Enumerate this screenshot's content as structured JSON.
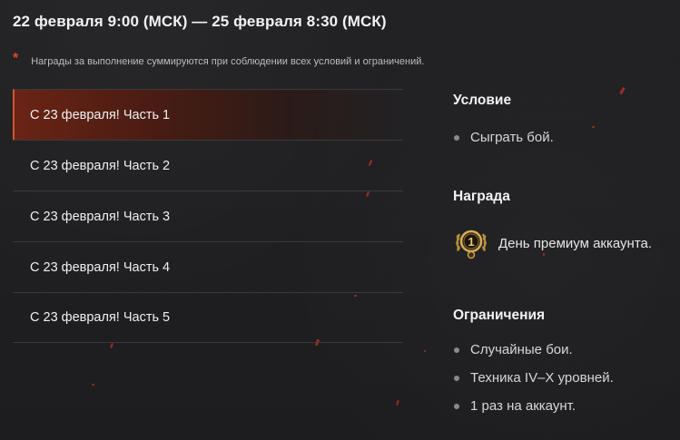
{
  "header": {
    "dates": "22 февраля 9:00 (МСК) — 25 февраля 8:30 (МСК)"
  },
  "note": {
    "marker": "*",
    "text": "Награды за выполнение суммируются при соблюдении всех условий и ограничений."
  },
  "tabs": [
    {
      "label": "С 23 февраля! Часть 1",
      "active": true
    },
    {
      "label": "С 23 февраля! Часть 2",
      "active": false
    },
    {
      "label": "С 23 февраля! Часть 3",
      "active": false
    },
    {
      "label": "С 23 февраля! Часть 4",
      "active": false
    },
    {
      "label": "С 23 февраля! Часть 5",
      "active": false
    }
  ],
  "condition": {
    "title": "Условие",
    "items": [
      "Сыграть бой."
    ]
  },
  "reward": {
    "title": "Награда",
    "badge_number": "1",
    "text": "День премиум аккаунта."
  },
  "restrictions": {
    "title": "Ограничения",
    "items": [
      "Случайные бои.",
      "Техника IV–X уровней.",
      "1 раз на аккаунт."
    ]
  },
  "colors": {
    "background": "#1f1f21",
    "accent": "#d3542e",
    "note_star": "#e0452b",
    "medal_gold": "#c9a049"
  },
  "icons": {
    "note_marker": "asterisk",
    "reward_badge": "premium-day-medal-icon",
    "bullet": "bullet-dot"
  }
}
